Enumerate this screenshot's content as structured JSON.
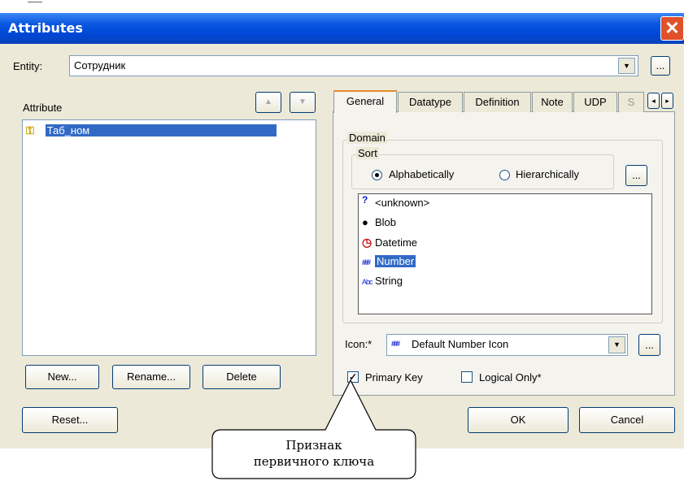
{
  "dialog": {
    "title": "Attributes",
    "close_glyph": "✕"
  },
  "entity": {
    "label": "Entity:",
    "value": "Сотрудник",
    "dropdown_glyph": "▼",
    "browse_label": "..."
  },
  "attribute": {
    "label": "Attribute",
    "move_up_glyph": "▲",
    "move_down_glyph": "▼",
    "items": [
      {
        "name": "Таб_ном",
        "icon": "key-icon",
        "selected": true
      }
    ],
    "new_label": "New...",
    "rename_label": "Rename...",
    "delete_label": "Delete"
  },
  "tabs": [
    {
      "label": "General",
      "active": true
    },
    {
      "label": "Datatype"
    },
    {
      "label": "Definition"
    },
    {
      "label": "Note"
    },
    {
      "label": "UDP"
    },
    {
      "label": "S"
    }
  ],
  "tab_scroll": {
    "left_glyph": "◂",
    "right_glyph": "▸"
  },
  "domain": {
    "legend": "Domain",
    "sort_legend": "Sort",
    "sort_alpha": "Alphabetically",
    "sort_hier": "Hierarchically",
    "sort_selected": "Alphabetically",
    "browse_label": "...",
    "items": [
      {
        "label": "<unknown>",
        "icon": "question-icon",
        "glyph": "?"
      },
      {
        "label": "Blob",
        "icon": "blob-icon",
        "glyph": "●"
      },
      {
        "label": "Datetime",
        "icon": "clock-icon",
        "glyph": "◷"
      },
      {
        "label": "Number",
        "icon": "number-icon",
        "glyph": "###",
        "selected": true
      },
      {
        "label": "String",
        "icon": "string-icon",
        "glyph": "Abc"
      }
    ]
  },
  "icon_field": {
    "label": "Icon:*",
    "glyph": "###",
    "value": "Default Number Icon",
    "dropdown_glyph": "▼",
    "browse_label": "..."
  },
  "checks": {
    "primary_key_label": "Primary Key",
    "primary_key_checked": true,
    "check_glyph": "✓",
    "logical_only_label": "Logical Only*",
    "logical_only_checked": false
  },
  "footer": {
    "reset_label": "Reset...",
    "ok_label": "OK",
    "cancel_label": "Cancel"
  },
  "callout": {
    "line1": "Признак",
    "line2": "первичного ключа"
  },
  "colors": {
    "titlebar": "#0a58e0",
    "selection": "#316ac5",
    "close": "#e0512b",
    "dialog_bg": "#ece9d8"
  }
}
